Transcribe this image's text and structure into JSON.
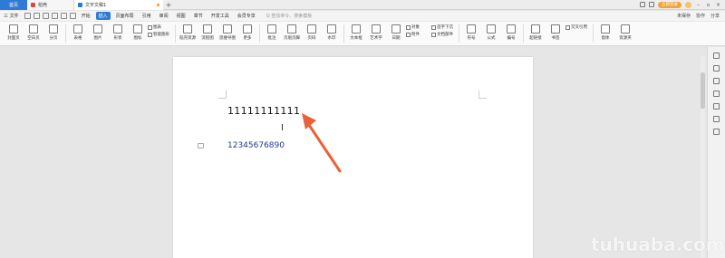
{
  "tabs": {
    "home": "首页",
    "shell": "稻壳",
    "doc": "文字文稿1",
    "new_tab": "+"
  },
  "titlebar_right": {
    "login": "立即登录"
  },
  "menu": {
    "file": "三 文件",
    "items": [
      "开始",
      "插入",
      "页面布局",
      "引用",
      "审阅",
      "视图",
      "章节",
      "开发工具",
      "会员专享"
    ],
    "active_index": 1,
    "search_placeholder": "Q 查找命令、搜索模板",
    "unsaved": "未保存",
    "collab": "协作",
    "share": "分享"
  },
  "ribbon": {
    "group1": [
      "封面页",
      "空白页",
      "分页",
      "表格",
      "图片",
      "形状",
      "图标"
    ],
    "small_a": [
      "图表",
      "智能图形"
    ],
    "group2": [
      "稻壳资源",
      "流程图",
      "思维导图",
      "更多"
    ],
    "group3": [
      "批注",
      "页眉页脚",
      "页码",
      "水印"
    ],
    "group4": [
      "文本框",
      "艺术字"
    ],
    "group5": [
      "日期"
    ],
    "small_b": [
      "对象",
      "附件"
    ],
    "small_c": [
      "首字下沉",
      "文档部件"
    ],
    "group6": [
      "符号",
      "公式",
      "编号"
    ],
    "group7": [
      "超链接",
      "书签"
    ],
    "small_d": [
      "交叉引用"
    ],
    "group8": [
      "窗体",
      "资源夹"
    ]
  },
  "document": {
    "line1": "11111111111",
    "line2": "12345676890"
  },
  "colors": {
    "accent": "#2f7ad7",
    "arrow": "#e8623a",
    "line2_text": "#1f3d8a"
  },
  "watermark": "tuhuaba.com"
}
